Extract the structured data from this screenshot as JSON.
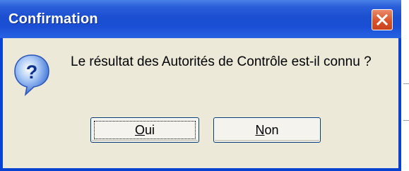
{
  "window": {
    "title": "Confirmation",
    "close_icon": "close-icon"
  },
  "content": {
    "icon": "question-icon",
    "message": "Le résultat des Autorités de Contrôle est-il connu ?"
  },
  "buttons": {
    "oui": {
      "mnemonic": "O",
      "rest": "ui"
    },
    "non": {
      "mnemonic": "N",
      "rest": "on"
    }
  },
  "colors": {
    "title_bar": "#1c4fd0",
    "dialog_bg": "#ece9d8",
    "close_button": "#d8532c"
  }
}
